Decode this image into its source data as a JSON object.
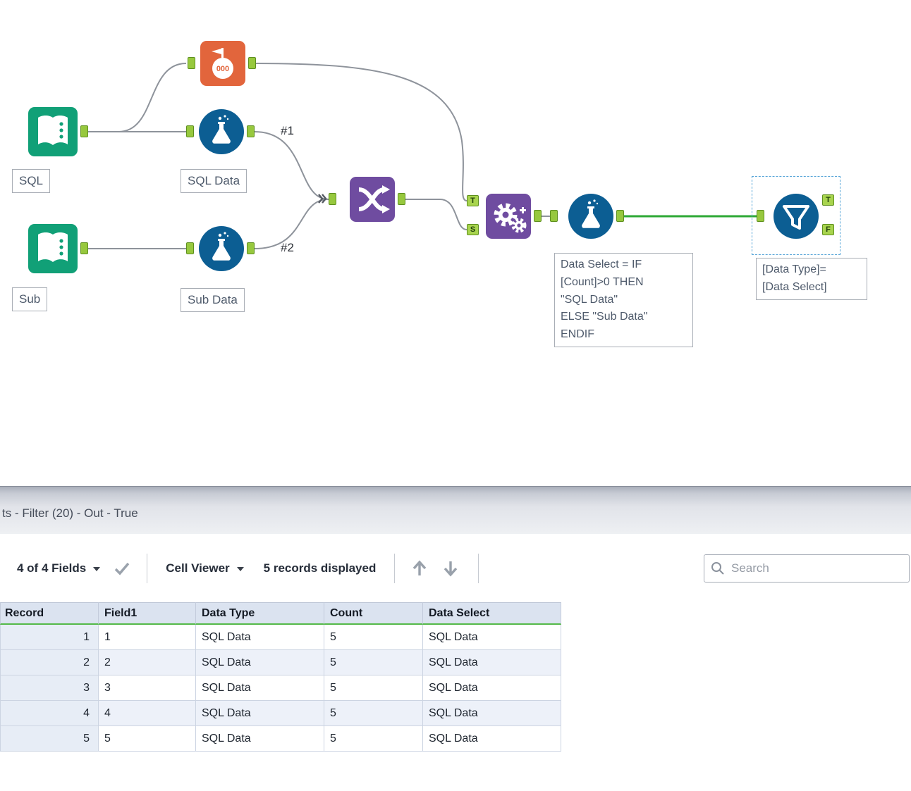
{
  "canvas": {
    "tools": {
      "input_sql": {
        "label": "SQL"
      },
      "input_sub": {
        "label": "Sub"
      },
      "count_records": {
        "counter": "000"
      },
      "formula_sql": {
        "label": "SQL Data"
      },
      "formula_sub": {
        "label": "Sub Data"
      },
      "formula_select": {
        "annotation": "Data Select = IF\n[Count]>0 THEN\n\"SQL Data\"\nELSE \"Sub Data\"\nENDIF"
      },
      "filter": {
        "annotation": "[Data Type]=\n[Data Select]"
      }
    },
    "anchors": {
      "t": "T",
      "s": "S",
      "f": "F"
    },
    "connection_labels": {
      "c1": "#1",
      "c2": "#2"
    },
    "colors": {
      "input_green": "#11A077",
      "count_orange": "#E2653C",
      "formula_blue": "#0C5E93",
      "purple": "#6F4CA0",
      "wire_gray": "#8E939B",
      "wire_green": "#2EA836",
      "anchor_green": "#97C83E"
    }
  },
  "results": {
    "title": "ts - Filter (20) - Out - True",
    "toolbar": {
      "fields": "4 of 4 Fields",
      "cell_viewer": "Cell Viewer",
      "records_displayed": "5 records displayed",
      "search_placeholder": "Search"
    },
    "table": {
      "columns": [
        "Record",
        "Field1",
        "Data Type",
        "Count",
        "Data Select"
      ],
      "rows": [
        [
          "1",
          "1",
          "SQL Data",
          "5",
          "SQL Data"
        ],
        [
          "2",
          "2",
          "SQL Data",
          "5",
          "SQL Data"
        ],
        [
          "3",
          "3",
          "SQL Data",
          "5",
          "SQL Data"
        ],
        [
          "4",
          "4",
          "SQL Data",
          "5",
          "SQL Data"
        ],
        [
          "5",
          "5",
          "SQL Data",
          "5",
          "SQL Data"
        ]
      ]
    }
  }
}
